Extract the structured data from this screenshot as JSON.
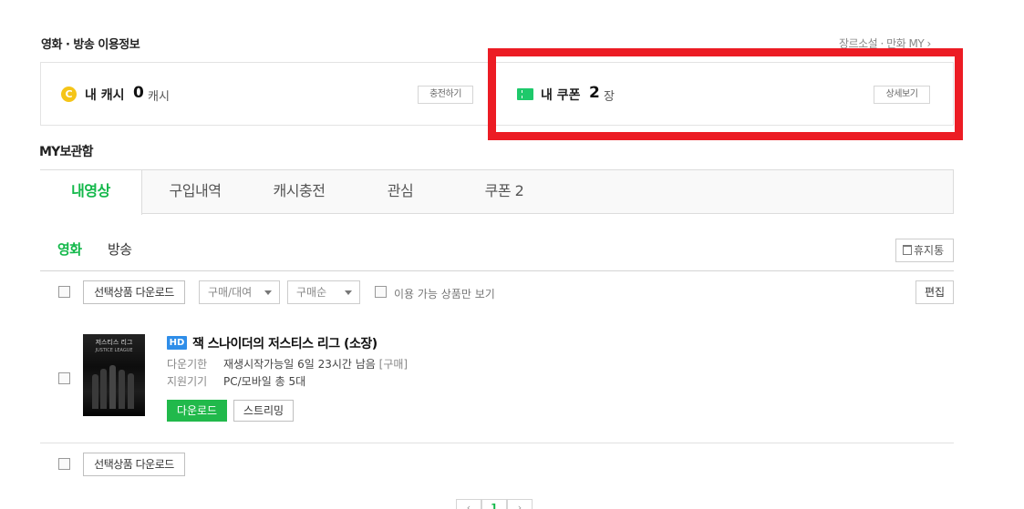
{
  "usage_info": {
    "title": "영화 · 방송 이용정보",
    "genre_link": "장르소설 · 만화 MY",
    "chevron_icon": "chevron-right-icon",
    "cash": {
      "icon": "coin-icon",
      "icon_glyph": "C",
      "icon_color": "#f5c518",
      "label": "내 캐시",
      "value": "0",
      "unit": "캐시",
      "button": "충전하기"
    },
    "coupon": {
      "icon": "ticket-icon",
      "icon_color": "#1ec96b",
      "label": "내 쿠폰",
      "value": "2",
      "unit": "장",
      "button": "상세보기"
    },
    "highlight_color": "#ec1c24"
  },
  "my_storage": {
    "title": "MY보관함",
    "tabs": [
      {
        "label": "내영상",
        "active": true
      },
      {
        "label": "구입내역",
        "active": false
      },
      {
        "label": "캐시충전",
        "active": false
      },
      {
        "label": "관심",
        "active": false
      },
      {
        "label": "쿠폰 2",
        "active": false
      }
    ],
    "accent_color": "#13b84a",
    "subtabs": [
      {
        "label": "영화",
        "active": true
      },
      {
        "label": "방송",
        "active": false
      }
    ],
    "trash_button": "휴지통",
    "trash_icon": "trash-icon"
  },
  "toolbar": {
    "download_selected": "선택상품 다운로드",
    "purchase_filter": "구매/대여",
    "sort_filter": "구매순",
    "available_only": "이용 가능 상품만 보기",
    "edit": "편집"
  },
  "items": [
    {
      "poster_text": "저스티스 리그",
      "poster_subtext": "JUSTICE LEAGUE",
      "badge": "HD",
      "badge_color": "#2f8ee9",
      "title": "잭 스나이더의 저스티스 리그 (소장)",
      "download_period_label": "다운기한",
      "download_period_value": "재생시작가능일 6일 23시간 남음",
      "purchase_tag": "[구매]",
      "devices_label": "지원기기",
      "devices_value": "PC/모바일 총 5대",
      "download_button": "다운로드",
      "download_button_color": "#21b94b",
      "streaming_button": "스트리밍"
    }
  ],
  "bottom_toolbar": {
    "download_selected": "선택상품 다운로드"
  },
  "pagination": {
    "prev": "‹",
    "current": "1",
    "next": "›"
  }
}
